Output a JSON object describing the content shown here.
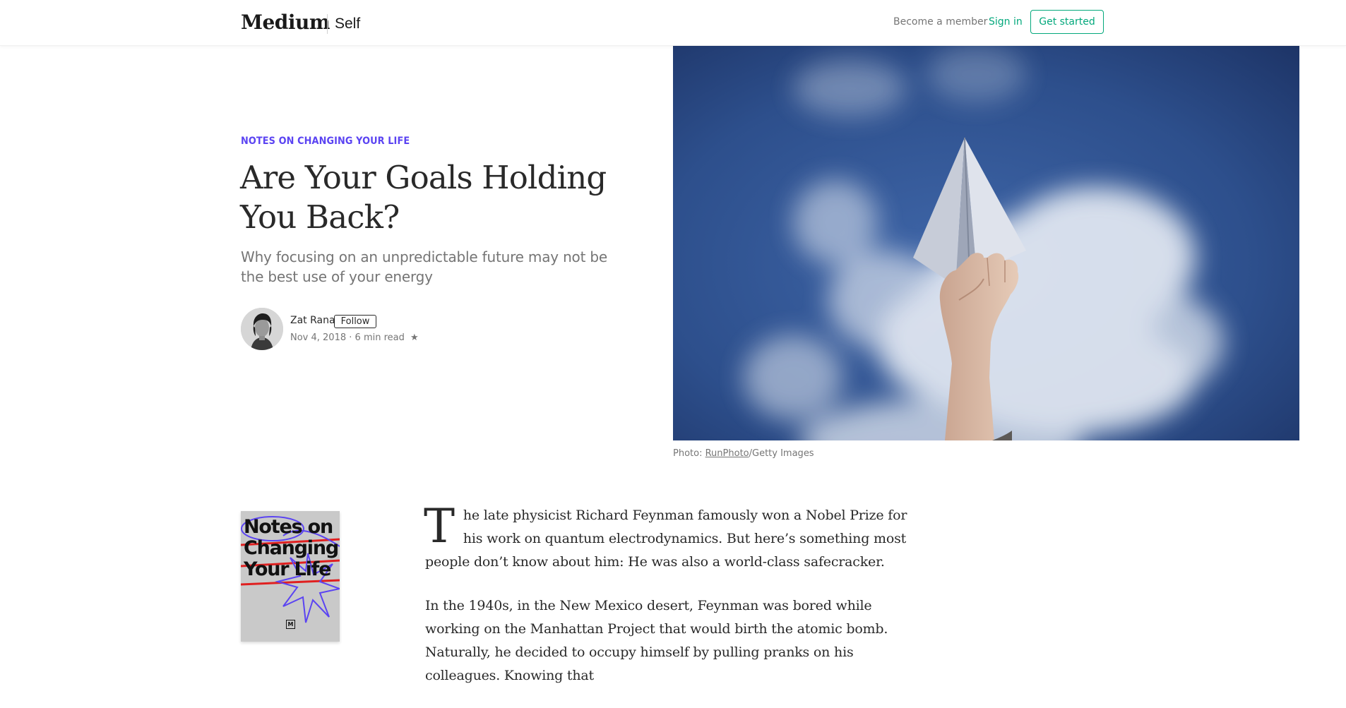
{
  "header": {
    "logo": "Medium",
    "publication": "Self",
    "become_member": "Become a member",
    "sign_in": "Sign in",
    "get_started": "Get started"
  },
  "article": {
    "kicker": "NOTES ON CHANGING YOUR LIFE",
    "title": "Are Your Goals Holding You Back?",
    "subtitle": "Why focusing on an unpredictable future may not be the best use of your energy",
    "author": {
      "name": "Zat Rana",
      "follow_label": "Follow",
      "date": "Nov 4, 2018",
      "separator": "·",
      "read_time": "6 min read",
      "star": "★"
    },
    "hero": {
      "caption_prefix": "Photo: ",
      "caption_link": "RunPhoto",
      "caption_suffix": "/Getty Images"
    },
    "book_cover": {
      "title": "Notes on Changing Your Life",
      "badge": "M"
    },
    "drop_cap": "T",
    "paragraph_1": "he late physicist Richard Feynman famously won a Nobel Prize for his work on quantum electrodynamics. But here’s something most people don’t know about him: He was also a world-class safecracker.",
    "paragraph_2": "In the 1940s, in the New Mexico desert, Feynman was bored while working on the Manhattan Project that would birth the atomic bomb. Naturally, he decided to occupy himself by pulling pranks on his colleagues. Knowing that"
  },
  "colors": {
    "accent_green": "#03a87c",
    "kicker_purple": "#5b44f2",
    "text": "#292929",
    "muted": "#757575"
  }
}
